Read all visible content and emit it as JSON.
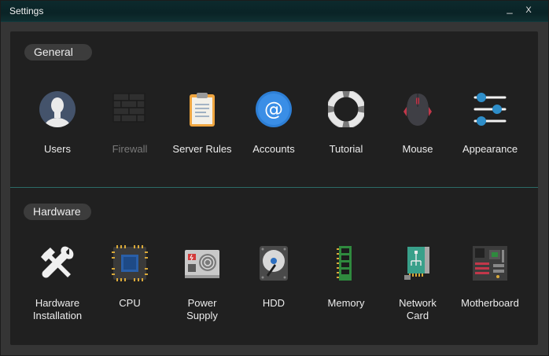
{
  "window": {
    "title": "Settings",
    "minimize_label": "_",
    "close_label": "X"
  },
  "sections": {
    "general": {
      "heading": "General",
      "items": [
        {
          "label": "Users",
          "icon": "user-avatar-icon",
          "enabled": true
        },
        {
          "label": "Firewall",
          "icon": "brick-wall-icon",
          "enabled": false
        },
        {
          "label": "Server Rules",
          "icon": "clipboard-icon",
          "enabled": true
        },
        {
          "label": "Accounts",
          "icon": "at-sign-icon",
          "enabled": true
        },
        {
          "label": "Tutorial",
          "icon": "lifebuoy-icon",
          "enabled": true
        },
        {
          "label": "Mouse",
          "icon": "mouse-icon",
          "enabled": true
        },
        {
          "label": "Appearance",
          "icon": "sliders-icon",
          "enabled": true
        }
      ]
    },
    "hardware": {
      "heading": "Hardware",
      "items": [
        {
          "label": "Hardware\nInstallation",
          "icon": "wrench-hammer-icon",
          "enabled": true
        },
        {
          "label": "CPU",
          "icon": "cpu-chip-icon",
          "enabled": true
        },
        {
          "label": "Power\nSupply",
          "icon": "power-supply-icon",
          "enabled": true
        },
        {
          "label": "HDD",
          "icon": "hard-drive-icon",
          "enabled": true
        },
        {
          "label": "Memory",
          "icon": "ram-stick-icon",
          "enabled": true
        },
        {
          "label": "Network\nCard",
          "icon": "network-card-icon",
          "enabled": true
        },
        {
          "label": "Motherboard",
          "icon": "motherboard-icon",
          "enabled": true
        }
      ]
    }
  },
  "colors": {
    "titlebar": "#0b2629",
    "panel": "#202020",
    "divider": "#2c6b68",
    "pill": "#3c3c3c",
    "accent_blue": "#2d7fd6"
  }
}
